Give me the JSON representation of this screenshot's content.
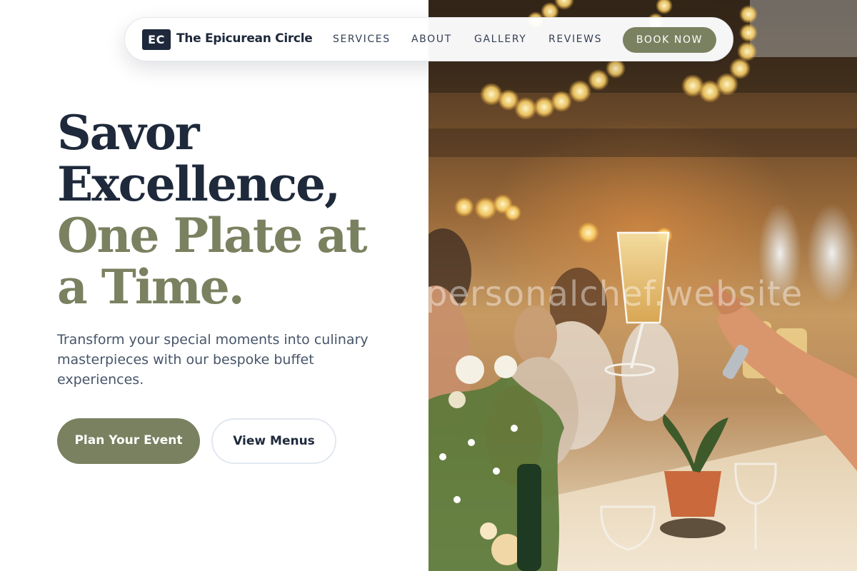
{
  "brand": {
    "initials": "EC",
    "name": "The Epicurean Circle"
  },
  "nav": {
    "links": [
      "SERVICES",
      "ABOUT",
      "GALLERY",
      "REVIEWS"
    ],
    "cta": "BOOK NOW"
  },
  "hero": {
    "headline_lines": [
      "Savor",
      "Excellence,"
    ],
    "headline_accent_lines": [
      "One Plate at",
      "a Time."
    ],
    "subtitle": "Transform your special moments into culinary masterpieces with our bespoke buffet experiences.",
    "primary_cta": "Plan Your Event",
    "secondary_cta": "View Menus"
  },
  "photo": {
    "watermark": "personalchef.website"
  },
  "colors": {
    "navy": "#1e293b",
    "olive": "#7a8160",
    "body_text": "#475569"
  }
}
